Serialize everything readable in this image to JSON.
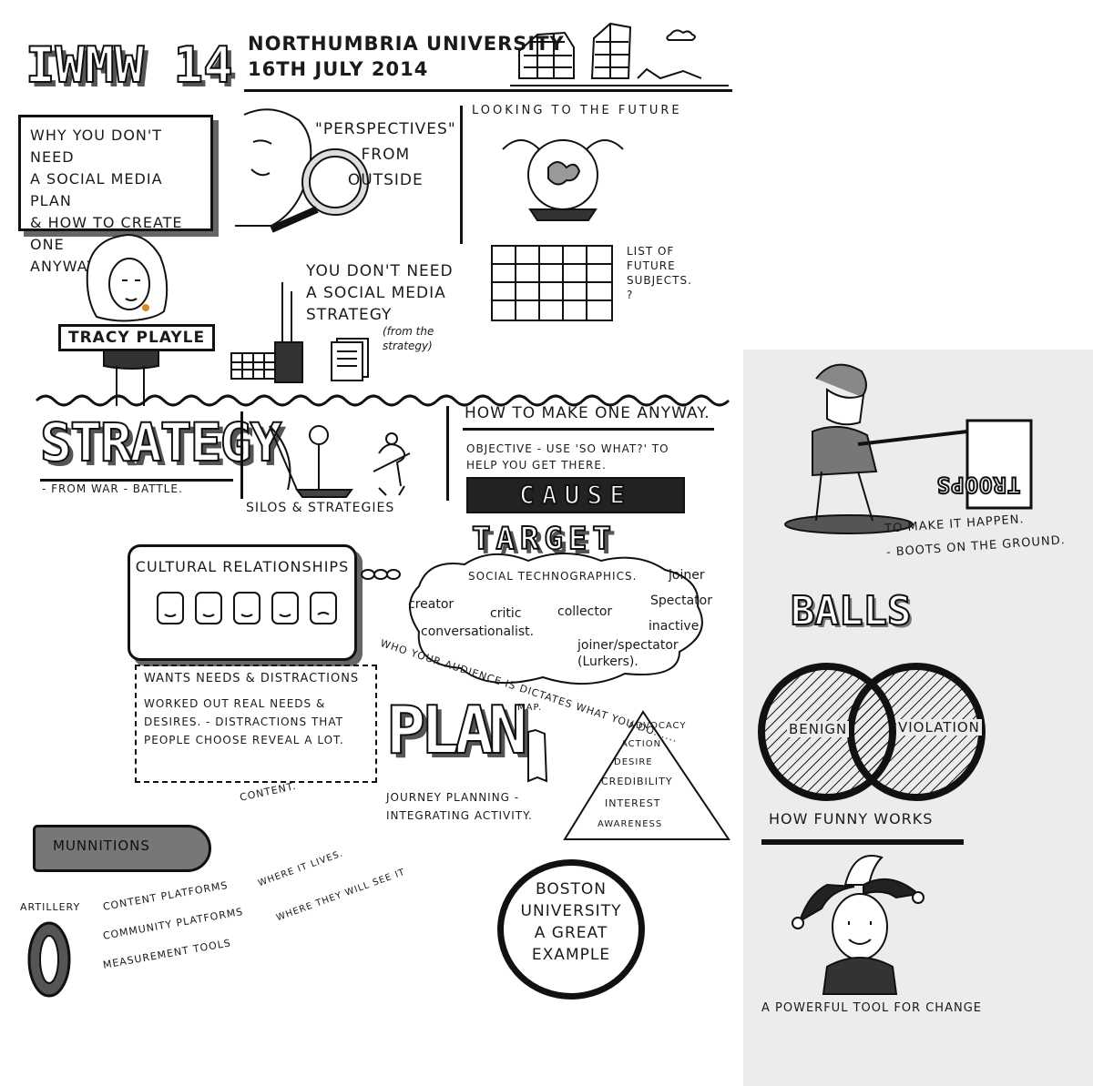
{
  "header": {
    "logo_text": "IWMW 14",
    "venue": "NORTHUMBRIA UNIVERSITY",
    "date": "16TH JULY 2014"
  },
  "talk": {
    "title": "WHY YOU DON'T NEED\nA SOCIAL MEDIA PLAN\n& HOW TO CREATE ONE\nANYWAY.",
    "speaker": "TRACY PLAYLE"
  },
  "perspectives": "\"PERSPECTIVES\"\nFROM\nOUTSIDE",
  "future": {
    "heading": "LOOKING TO THE FUTURE",
    "note": "LIST OF\nFUTURE\nSUBJECTS.\n?"
  },
  "no_strategy": {
    "text": "YOU DON'T NEED\nA SOCIAL MEDIA\nSTRATEGY",
    "aside": "(from the\nstrategy)"
  },
  "strategy": {
    "word": "STRATEGY",
    "sub": "- FROM WAR - BATTLE.",
    "silos": "SILOS & STRATEGIES"
  },
  "how_to": {
    "heading": "HOW TO MAKE ONE ANYWAY.",
    "objective": "OBJECTIVE - USE 'SO WHAT?' TO\nHELP YOU GET THERE.",
    "cause": "CAUSE",
    "target": "TARGET"
  },
  "technographics": {
    "heading": "SOCIAL TECHNOGRAPHICS.",
    "items": [
      "joiner",
      "creator",
      "critic",
      "collector",
      "Spectator",
      "inactive",
      "conversationalist.",
      "joiner/spectator\n(Lurkers)."
    ],
    "caption": "WHO YOUR AUDIENCE IS DICTATES WHAT YOU DO......"
  },
  "cultural": {
    "heading": "CULTURAL RELATIONSHIPS",
    "wants_heading": "WANTS NEEDS & DISTRACTIONS",
    "wants_body": "WORKED OUT REAL NEEDS &\nDESIRES. - DISTRACTIONS THAT\nPEOPLE CHOOSE REVEAL A LOT."
  },
  "plan": {
    "word": "PLAN",
    "map": "MAP.",
    "sub": "JOURNEY PLANNING -\nINTEGRATING ACTIVITY.",
    "pyramid": [
      "ADVOCACY",
      "ACTION",
      "DESIRE",
      "CREDIBILITY",
      "INTEREST",
      "AWARENESS"
    ]
  },
  "munitions": {
    "label": "MUNNITIONS",
    "content": "CONTENT."
  },
  "artillery": {
    "label": "ARTILLERY",
    "items": [
      "CONTENT PLATFORMS",
      "COMMUNITY PLATFORMS",
      "MEASUREMENT TOOLS"
    ],
    "where_lives": "WHERE IT LIVES.",
    "where_see": "WHERE THEY WILL SEE IT"
  },
  "boston": "BOSTON\nUNIVERSITY\nA GREAT\nEXAMPLE",
  "troops": {
    "flag": "TROOPS",
    "caption": "TO MAKE IT HAPPEN.\n- BOOTS ON THE GROUND."
  },
  "balls": {
    "title": "BALLS",
    "left": "BENIGN",
    "right": "VIOLATION",
    "caption": "HOW FUNNY WORKS",
    "tool": "A POWERFUL TOOL FOR CHANGE"
  }
}
